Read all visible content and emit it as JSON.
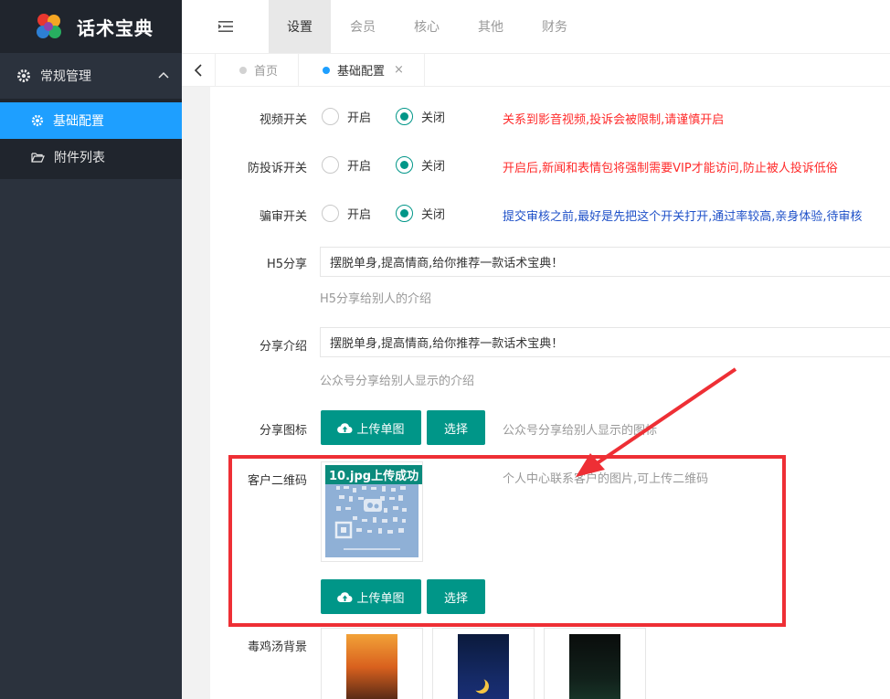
{
  "app": {
    "title": "话术宝典"
  },
  "sidebar": {
    "group_label": "常规管理",
    "items": [
      {
        "label": "基础配置"
      },
      {
        "label": "附件列表"
      }
    ]
  },
  "topnav": {
    "tabs": [
      "设置",
      "会员",
      "核心",
      "其他",
      "财务"
    ]
  },
  "tabstrip": {
    "tabs": [
      {
        "label": "首页"
      },
      {
        "label": "基础配置"
      }
    ],
    "close_glyph": "×"
  },
  "form": {
    "radio_on_label": "开启",
    "radio_off_label": "关闭",
    "video_switch": {
      "label": "视频开关",
      "hint": "关系到影音视频,投诉会被限制,请谨慎开启",
      "selected": "关闭"
    },
    "anti_complaint_switch": {
      "label": "防投诉开关",
      "hint": "开启后,新闻和表情包将强制需要VIP才能访问,防止被人投诉低俗",
      "selected": "关闭"
    },
    "review_switch": {
      "label": "骗审开关",
      "hint": "提交审核之前,最好是先把这个开关打开,通过率较高,亲身体验,待审核",
      "selected": "关闭"
    },
    "h5_share": {
      "label": "H5分享",
      "value": "摆脱单身,提高情商,给你推荐一款话术宝典！",
      "hint": "H5分享给别人的介绍"
    },
    "share_intro": {
      "label": "分享介绍",
      "value": "摆脱单身,提高情商,给你推荐一款话术宝典！",
      "hint": "公众号分享给别人显示的介绍"
    },
    "share_icon": {
      "label": "分享图标",
      "upload_label": "上传单图",
      "choose_label": "选择",
      "hint": "公众号分享给别人显示的图标"
    },
    "customer_qr": {
      "label": "客户二维码",
      "upload_status": "10.jpg上传成功",
      "hint": "个人中心联系客户的图片,可上传二维码",
      "upload_label": "上传单图",
      "choose_label": "选择"
    },
    "soup_bg": {
      "label": "毒鸡汤背景"
    }
  },
  "colors": {
    "sidebar_bg": "#2b323d",
    "sidebar_active": "#1e9fff",
    "primary_button": "#009688",
    "warning_text": "#ff2b2b",
    "info_text": "#1e50c8",
    "annotation_red": "#ee2f35"
  }
}
